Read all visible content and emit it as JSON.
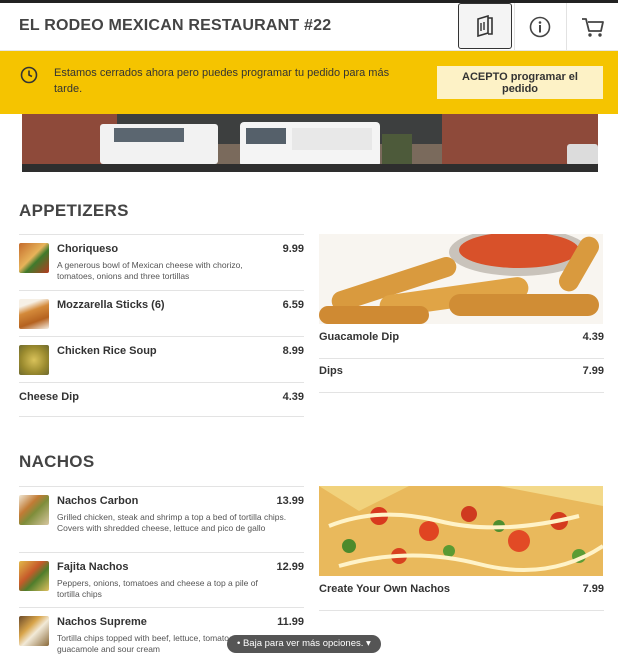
{
  "header": {
    "title": "EL RODEO MEXICAN RESTAURANT #22",
    "icons": [
      "menu-book-icon",
      "info-icon",
      "cart-icon"
    ]
  },
  "banner": {
    "message": "Estamos cerrados ahora pero puedes programar tu pedido para más tarde.",
    "button_label": "ACEPTO programar el pedido",
    "color": "#f5c400"
  },
  "sections": [
    {
      "title": "APPETIZERS",
      "items": [
        {
          "name": "Choriqueso",
          "price": "9.99",
          "description": "A generous bowl of Mexican cheese with chorizo, tomatoes, onions and three tortillas"
        },
        {
          "name": "Mozzarella Sticks (6)",
          "price": "6.59",
          "description": ""
        },
        {
          "name": "Chicken Rice Soup",
          "price": "8.99",
          "description": ""
        },
        {
          "name": "Cheese Dip",
          "price": "4.39",
          "description": ""
        },
        {
          "name": "Guacamole Dip",
          "price": "4.39",
          "description": ""
        },
        {
          "name": "Dips",
          "price": "7.99",
          "description": ""
        }
      ]
    },
    {
      "title": "NACHOS",
      "items": [
        {
          "name": "Nachos Carbon",
          "price": "13.99",
          "description": "Grilled chicken, steak and shrimp a top a bed of tortilla chips. Covers with shredded cheese, lettuce and pico de gallo"
        },
        {
          "name": "Fajita Nachos",
          "price": "12.99",
          "description": "Peppers, onions, tomatoes and cheese a top a pile of tortilla chips"
        },
        {
          "name": "Nachos Supreme",
          "price": "11.99",
          "description": "Tortilla chips topped with beef, lettuce, tomatoes, guacamole and sour cream"
        },
        {
          "name": "Create Your Own Nachos",
          "price": "7.99",
          "description": ""
        }
      ]
    }
  ],
  "scroll_hint": "Baja para ver más opciones."
}
